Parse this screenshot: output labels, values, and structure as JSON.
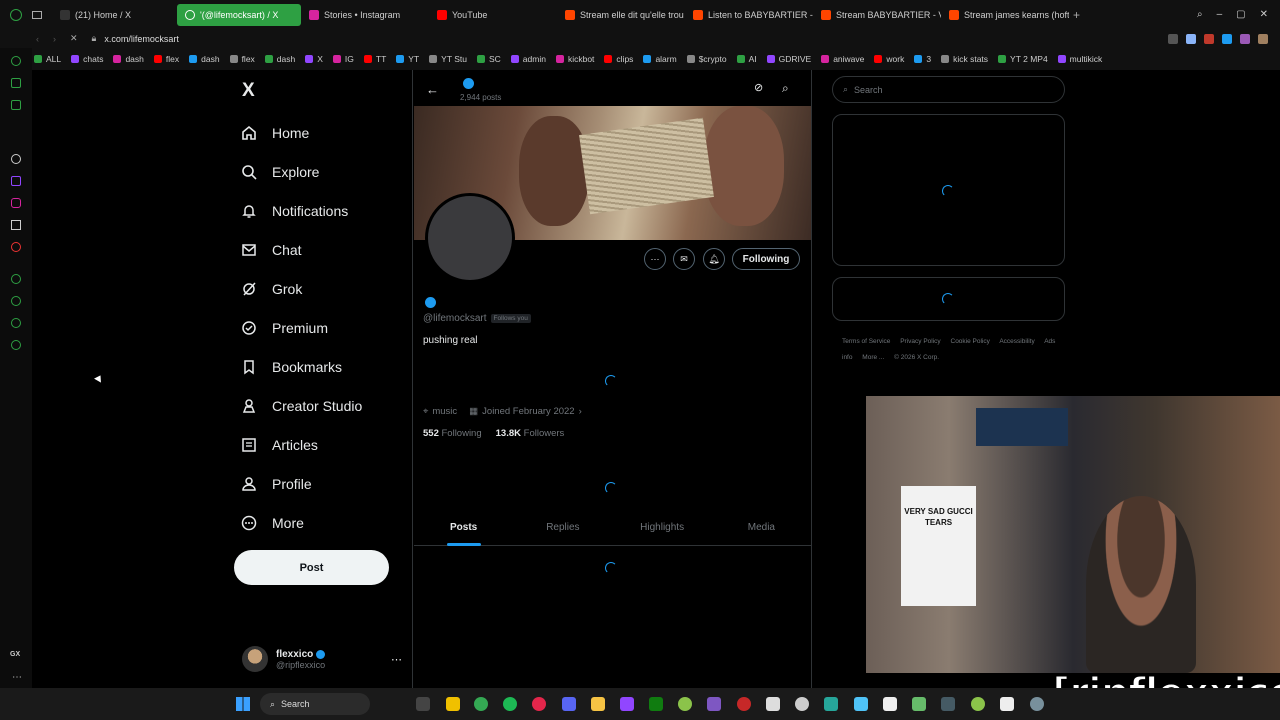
{
  "browser": {
    "tabs": [
      {
        "label": "(21) Home / X",
        "color": "#333333"
      },
      {
        "label": "'(@lifemocksart) / X",
        "color": "#2ea043",
        "active": true
      },
      {
        "label": "Stories • Instagram",
        "color": "#d6249f"
      },
      {
        "label": "YouTube",
        "color": "#ff0000"
      },
      {
        "label": "Stream elle dit qu'elle trou",
        "color": "#ff4500"
      },
      {
        "label": "Listen to BABYBARTIER -",
        "color": "#ff4500"
      },
      {
        "label": "Stream BABYBARTIER - V",
        "color": "#ff4500"
      },
      {
        "label": "Stream james kearns (hoftt",
        "color": "#ff4500"
      }
    ],
    "url": "x.com/lifemocksart",
    "bookmarks": [
      "ALL",
      "chats",
      "dash",
      "flex",
      "dash",
      "flex",
      "dash",
      "X",
      "IG",
      "TT",
      "YT",
      "YT Stu",
      "SC",
      "admin",
      "kickbot",
      "clips",
      "alarm",
      "$crypto",
      "AI",
      "GDRIVE",
      "aniwave",
      "work",
      "3",
      "kick stats",
      "YT 2 MP4",
      "multikick"
    ]
  },
  "nav": {
    "logo": "X",
    "items": [
      {
        "label": "Home",
        "icon": "home-icon"
      },
      {
        "label": "Explore",
        "icon": "search-icon"
      },
      {
        "label": "Notifications",
        "icon": "bell-icon"
      },
      {
        "label": "Chat",
        "icon": "mail-icon"
      },
      {
        "label": "Grok",
        "icon": "grok-icon"
      },
      {
        "label": "Premium",
        "icon": "verified-icon"
      },
      {
        "label": "Bookmarks",
        "icon": "bookmark-icon"
      },
      {
        "label": "Creator Studio",
        "icon": "creator-icon"
      },
      {
        "label": "Articles",
        "icon": "article-icon"
      },
      {
        "label": "Profile",
        "icon": "person-icon"
      },
      {
        "label": "More",
        "icon": "more-icon"
      }
    ],
    "post_label": "Post"
  },
  "account": {
    "name": "flexxico",
    "handle": "@ripflexxico"
  },
  "profile": {
    "posts_count": "2,944 posts",
    "handle": "@lifemocksart",
    "follows_you": "Follows you",
    "bio": "pushing real",
    "category": "music",
    "joined": "Joined February 2022",
    "following_count": "552",
    "following_label": "Following",
    "followers_count": "13.8K",
    "followers_label": "Followers",
    "following_button": "Following",
    "tabs": [
      "Posts",
      "Replies",
      "Highlights",
      "Media"
    ]
  },
  "right": {
    "search_placeholder": "Search",
    "footer": [
      "Terms of Service",
      "Privacy Policy",
      "Cookie Policy",
      "Accessibility",
      "Ads info",
      "More ...",
      "© 2026 X Corp."
    ]
  },
  "stream": {
    "overlay_text": "[ripflexxico]",
    "shirt_text": "VERY SAD GUCCI TEARS"
  },
  "taskbar": {
    "search_label": "Search"
  },
  "colors": {
    "accent": "#1d9bf0",
    "background": "#000000",
    "browser_accent": "#2ea043"
  }
}
